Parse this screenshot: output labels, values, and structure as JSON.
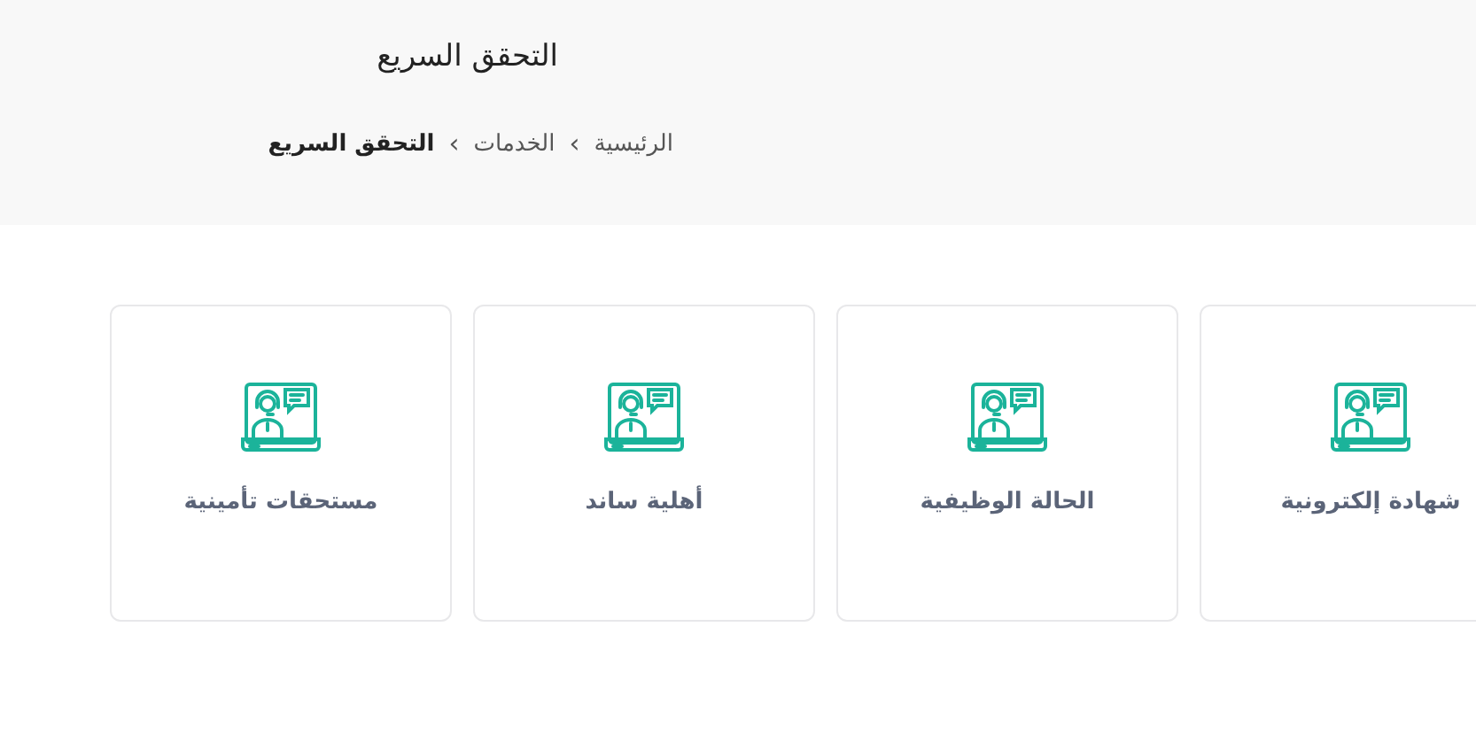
{
  "header": {
    "title": "التحقق السريع",
    "breadcrumb": [
      {
        "label": "الرئيسية",
        "current": false
      },
      {
        "label": "الخدمات",
        "current": false
      },
      {
        "label": "التحقق السريع",
        "current": true
      }
    ],
    "separator": "›"
  },
  "services": [
    {
      "label": "شهادة إلكترونية"
    },
    {
      "label": "الحالة الوظيفية"
    },
    {
      "label": "أهلية ساند"
    },
    {
      "label": "مستحقات تأمينية"
    }
  ]
}
